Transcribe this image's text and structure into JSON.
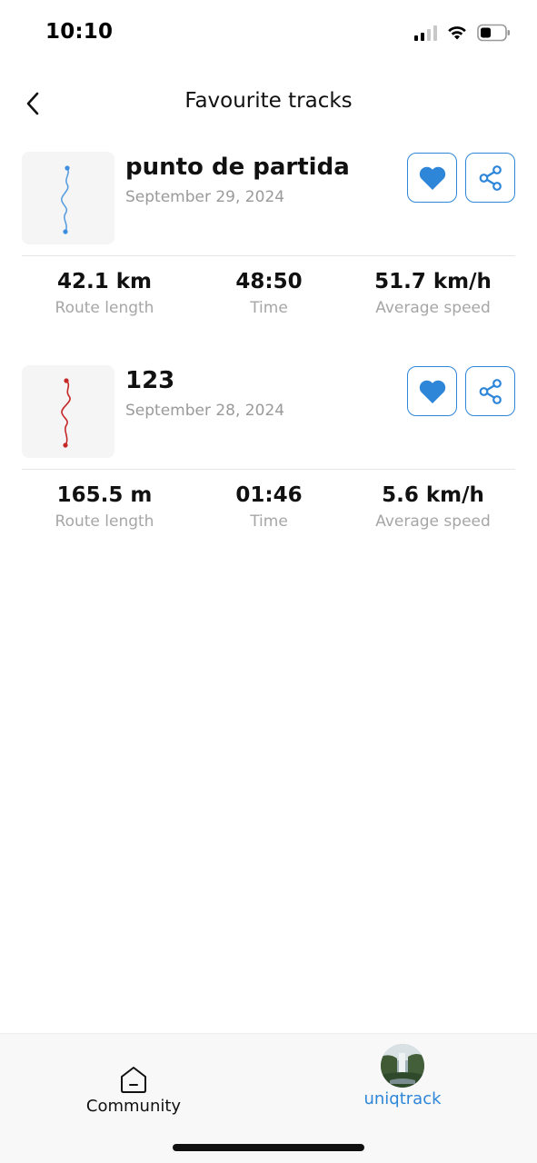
{
  "status_bar": {
    "time": "10:10",
    "icons": [
      "cellular-signal-icon",
      "wifi-icon",
      "battery-icon"
    ]
  },
  "header": {
    "back_icon": "chevron-left-icon",
    "title": "Favourite tracks"
  },
  "tracks": [
    {
      "name": "punto de partida",
      "date": "September 29, 2024",
      "route_color": "#5b9fe0",
      "stats": [
        {
          "value": "42.1 km",
          "label": "Route length"
        },
        {
          "value": "48:50",
          "label": "Time"
        },
        {
          "value": "51.7 km/h",
          "label": "Average speed"
        }
      ]
    },
    {
      "name": "123",
      "date": "September 28, 2024",
      "route_color": "#c62828",
      "stats": [
        {
          "value": "165.5 m",
          "label": "Route length"
        },
        {
          "value": "01:46",
          "label": "Time"
        },
        {
          "value": "5.6 km/h",
          "label": "Average speed"
        }
      ]
    }
  ],
  "tab_bar": {
    "community_label": "Community",
    "profile_label": "uniqtrack",
    "community_icon": "home-icon",
    "profile_icon": "avatar-waterfall"
  },
  "colors": {
    "accent": "#2e86d9",
    "muted_text": "#a6a6a6"
  }
}
